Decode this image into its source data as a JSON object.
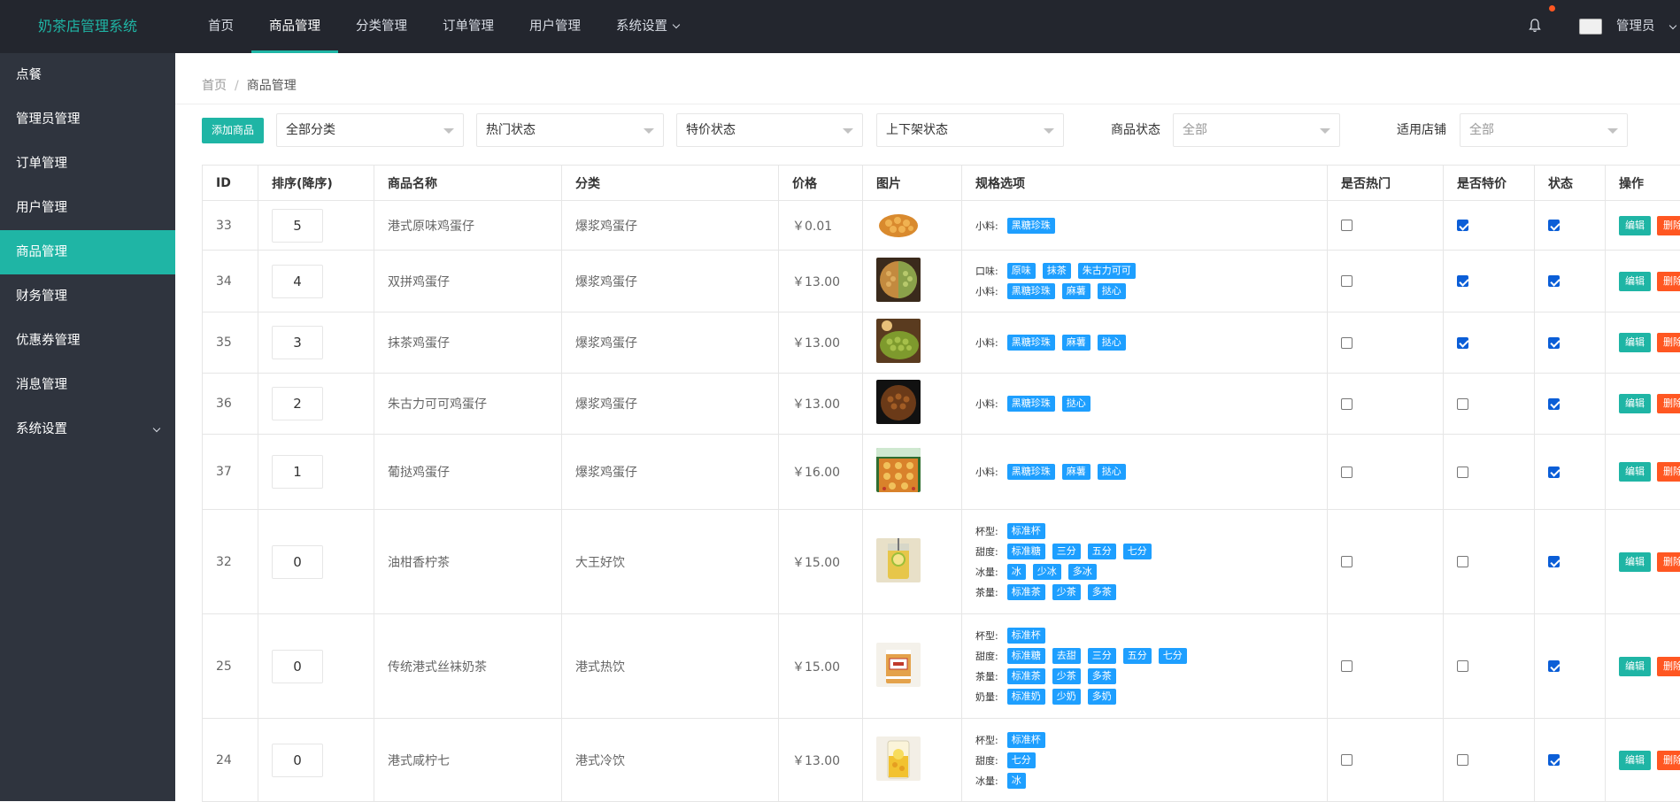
{
  "app": {
    "title": "奶茶店管理系统"
  },
  "topnav": [
    {
      "label": "首页",
      "active": false
    },
    {
      "label": "商品管理",
      "active": true
    },
    {
      "label": "分类管理",
      "active": false
    },
    {
      "label": "订单管理",
      "active": false
    },
    {
      "label": "用户管理",
      "active": false
    },
    {
      "label": "系统设置",
      "active": false,
      "dropdown": true
    }
  ],
  "user": {
    "name": "管理员"
  },
  "sidebar": [
    {
      "label": "点餐"
    },
    {
      "label": "管理员管理"
    },
    {
      "label": "订单管理"
    },
    {
      "label": "用户管理"
    },
    {
      "label": "商品管理",
      "active": true
    },
    {
      "label": "财务管理"
    },
    {
      "label": "优惠券管理"
    },
    {
      "label": "消息管理"
    },
    {
      "label": "系统设置",
      "dropdown": true
    }
  ],
  "breadcrumb": {
    "home": "首页",
    "sep": "/",
    "current": "商品管理"
  },
  "toolbar": {
    "add_label": "添加商品",
    "category_select": "全部分类",
    "hot_select": "热门状态",
    "special_select": "特价状态",
    "shelf_select": "上下架状态",
    "status_label": "商品状态",
    "status_placeholder": "全部",
    "store_label": "适用店铺",
    "store_placeholder": "全部"
  },
  "table": {
    "headers": [
      "ID",
      "排序(降序)",
      "商品名称",
      "分类",
      "价格",
      "图片",
      "规格选项",
      "是否热门",
      "是否特价",
      "状态",
      "操作"
    ],
    "edit_label": "编辑",
    "delete_label": "删除",
    "rows": [
      {
        "id": "33",
        "sort": "5",
        "name": "港式原味鸡蛋仔",
        "category": "爆浆鸡蛋仔",
        "price": "￥0.01",
        "image": "egg-waffle",
        "specs": [
          {
            "name": "小料:",
            "options": [
              "黑糖珍珠"
            ]
          }
        ],
        "hot": false,
        "special": true,
        "status": true
      },
      {
        "id": "34",
        "sort": "4",
        "name": "双拼鸡蛋仔",
        "category": "爆浆鸡蛋仔",
        "price": "￥13.00",
        "image": "double-waffle",
        "specs": [
          {
            "name": "口味:",
            "options": [
              "原味",
              "抹茶",
              "朱古力可可"
            ]
          },
          {
            "name": "小料:",
            "options": [
              "黑糖珍珠",
              "麻薯",
              "挞心"
            ]
          }
        ],
        "hot": false,
        "special": true,
        "status": true
      },
      {
        "id": "35",
        "sort": "3",
        "name": "抹茶鸡蛋仔",
        "category": "爆浆鸡蛋仔",
        "price": "￥13.00",
        "image": "matcha-waffle",
        "specs": [
          {
            "name": "小料:",
            "options": [
              "黑糖珍珠",
              "麻薯",
              "挞心"
            ]
          }
        ],
        "hot": false,
        "special": true,
        "status": true
      },
      {
        "id": "36",
        "sort": "2",
        "name": "朱古力可可鸡蛋仔",
        "category": "爆浆鸡蛋仔",
        "price": "￥13.00",
        "image": "choco-waffle",
        "specs": [
          {
            "name": "小料:",
            "options": [
              "黑糖珍珠",
              "挞心"
            ]
          }
        ],
        "hot": false,
        "special": false,
        "status": true
      },
      {
        "id": "37",
        "sort": "1",
        "name": "葡挞鸡蛋仔",
        "category": "爆浆鸡蛋仔",
        "price": "￥16.00",
        "image": "tart-waffle",
        "specs": [
          {
            "name": "小料:",
            "options": [
              "黑糖珍珠",
              "麻薯",
              "挞心"
            ]
          }
        ],
        "hot": false,
        "special": false,
        "status": true
      },
      {
        "id": "32",
        "sort": "0",
        "name": "油柑香柠茶",
        "category": "大王好饮",
        "price": "￥15.00",
        "image": "lemon-tea",
        "specs": [
          {
            "name": "杯型:",
            "options": [
              "标准杯"
            ]
          },
          {
            "name": "甜度:",
            "options": [
              "标准糖",
              "三分",
              "五分",
              "七分"
            ]
          },
          {
            "name": "冰量:",
            "options": [
              "冰",
              "少冰",
              "多冰"
            ]
          },
          {
            "name": "茶量:",
            "options": [
              "标准茶",
              "少茶",
              "多茶"
            ]
          }
        ],
        "hot": false,
        "special": false,
        "status": true
      },
      {
        "id": "25",
        "sort": "0",
        "name": "传统港式丝袜奶茶",
        "category": "港式热饮",
        "price": "￥15.00",
        "image": "milk-tea",
        "specs": [
          {
            "name": "杯型:",
            "options": [
              "标准杯"
            ]
          },
          {
            "name": "甜度:",
            "options": [
              "标准糖",
              "去甜",
              "三分",
              "五分",
              "七分"
            ]
          },
          {
            "name": "茶量:",
            "options": [
              "标准茶",
              "少茶",
              "多茶"
            ]
          },
          {
            "name": "奶量:",
            "options": [
              "标准奶",
              "少奶",
              "多奶"
            ]
          }
        ],
        "hot": false,
        "special": false,
        "status": true
      },
      {
        "id": "24",
        "sort": "0",
        "name": "港式咸柠七",
        "category": "港式冷饮",
        "price": "￥13.00",
        "image": "lemon-seven",
        "specs": [
          {
            "name": "杯型:",
            "options": [
              "标准杯"
            ]
          },
          {
            "name": "甜度:",
            "options": [
              "七分"
            ]
          },
          {
            "name": "冰量:",
            "options": [
              "冰"
            ]
          }
        ],
        "hot": false,
        "special": false,
        "status": true
      }
    ]
  }
}
